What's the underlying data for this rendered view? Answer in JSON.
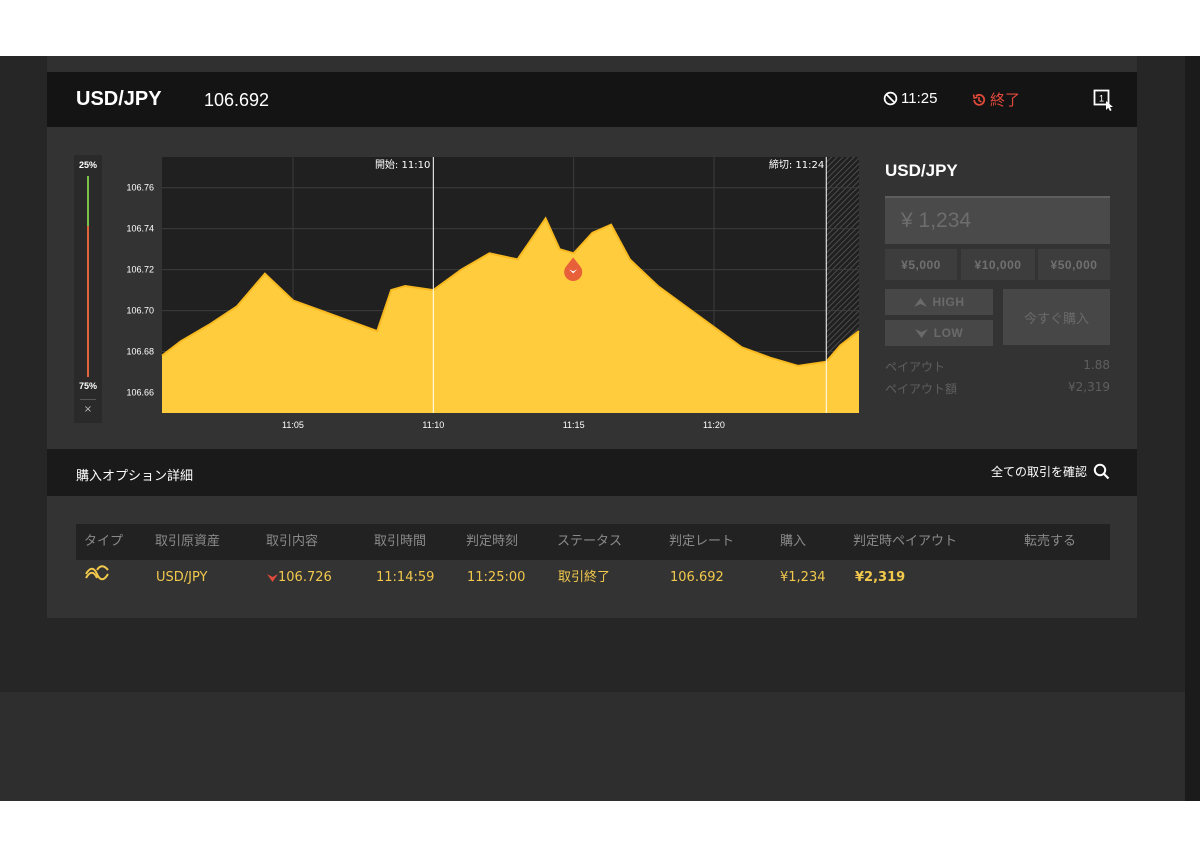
{
  "header": {
    "symbol": "USD/JPY",
    "price": "106.692",
    "time": "11:25",
    "status": "終了"
  },
  "gauge": {
    "top_label": "25%",
    "bottom_label": "75%",
    "close": "×",
    "high_fraction": 0.25,
    "low_fraction": 0.75
  },
  "chart_data": {
    "type": "area",
    "y_ticks": [
      "106.76",
      "106.74",
      "106.72",
      "106.70",
      "106.68",
      "106.66"
    ],
    "x_ticks": [
      "11:05",
      "11:10",
      "11:15",
      "11:20"
    ],
    "ylim": [
      106.65,
      106.775
    ],
    "xlim": [
      "11:00:20",
      "11:25:10"
    ],
    "start_label": "開始: 11:10",
    "end_label": "締切: 11:24",
    "start_time": "11:10",
    "end_time": "11:24",
    "entry_point": {
      "x": "11:14:59",
      "y": 106.726
    },
    "x": [
      "11:00:20",
      "11:01:00",
      "11:02:00",
      "11:03:00",
      "11:04:00",
      "11:05:00",
      "11:06:00",
      "11:07:00",
      "11:08:00",
      "11:08:30",
      "11:09:00",
      "11:10:00",
      "11:11:00",
      "11:12:00",
      "11:13:00",
      "11:13:30",
      "11:14:00",
      "11:14:30",
      "11:15:00",
      "11:15:40",
      "11:16:20",
      "11:17:00",
      "11:18:00",
      "11:19:00",
      "11:20:00",
      "11:21:00",
      "11:22:00",
      "11:23:00",
      "11:24:00",
      "11:24:30",
      "11:25:10"
    ],
    "y": [
      106.678,
      106.685,
      106.693,
      106.702,
      106.718,
      106.705,
      106.7,
      106.695,
      106.69,
      106.71,
      106.712,
      106.71,
      106.72,
      106.728,
      106.725,
      106.735,
      106.745,
      106.73,
      106.728,
      106.738,
      106.742,
      106.725,
      106.712,
      106.702,
      106.692,
      106.682,
      106.677,
      106.673,
      106.675,
      106.683,
      106.69
    ],
    "series_color": "#f7b91f",
    "fill_color": "#ffcc3d"
  },
  "trade_panel": {
    "symbol": "USD/JPY",
    "amount": "¥ 1,234",
    "presets": [
      "¥5,000",
      "¥10,000",
      "¥50,000"
    ],
    "high_label": "HIGH",
    "low_label": "LOW",
    "buy_label": "今すぐ購入",
    "payout_label": "ペイアウト",
    "payout_value": "1.88",
    "payout_amount_label": "ペイアウト額",
    "payout_amount_value": "¥2,319"
  },
  "details": {
    "title": "購入オプション詳細",
    "view_all": "全ての取引を確認",
    "columns": [
      "タイプ",
      "取引原資産",
      "取引内容",
      "取引時間",
      "判定時刻",
      "ステータス",
      "判定レート",
      "購入",
      "判定時ペイアウト",
      "転売する"
    ],
    "row": {
      "asset": "USD/JPY",
      "content": "106.726",
      "trade_time": "11:14:59",
      "judge_time": "11:25:00",
      "status": "取引終了",
      "judge_rate": "106.692",
      "purchase": "¥1,234",
      "payout": "¥2,319"
    }
  },
  "colors": {
    "accent": "#f2c94c",
    "danger": "#e04a3a",
    "marker": "#e8603a"
  }
}
